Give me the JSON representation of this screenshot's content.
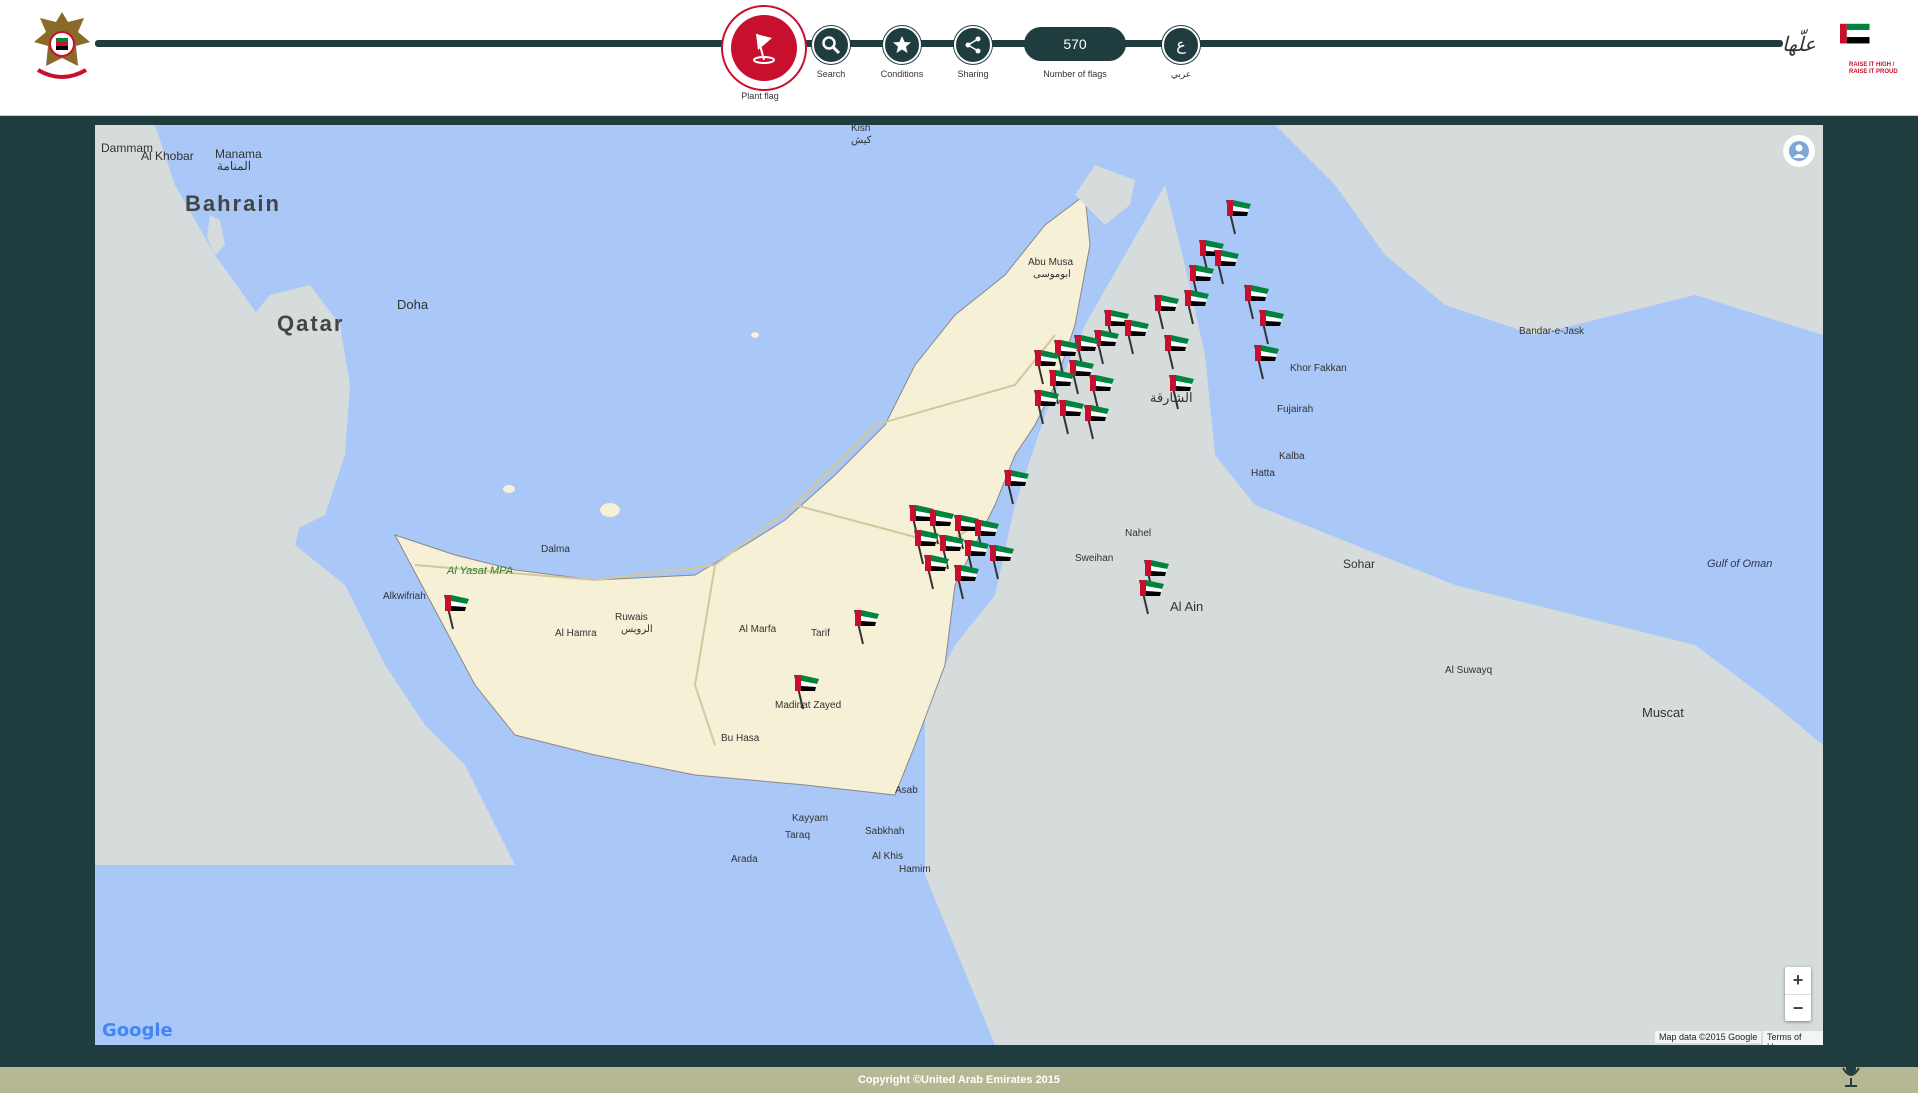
{
  "header": {
    "brand_tagline": "RAISE IT HIGH / RAISE IT PROUD",
    "brand_script": "علّها",
    "toolbar": {
      "plant_flag": "Plant flag",
      "search": "Search",
      "conditions": "Conditions",
      "sharing": "Sharing",
      "flag_count": "570",
      "flag_count_label": "Number of flags",
      "language_glyph": "ع",
      "language_label": "عربي"
    }
  },
  "map": {
    "labels": {
      "bahrain": "Bahrain",
      "qatar": "Qatar",
      "manama": "Manama",
      "manama_ar": "المنامة",
      "dammam": "Dammam",
      "alkhobar": "Al Khobar",
      "doha": "Doha",
      "kish": "Kish",
      "kish_ar": "کیش",
      "abu_musa": "Abu Musa",
      "abu_musa_ar": "ابوموسی",
      "dalma": "Dalma",
      "ruwais": "Ruwais",
      "ruwais_ar": "الرويس",
      "al_hamra": "Al Hamra",
      "al_marfa": "Al Marfa",
      "tarif": "Tarif",
      "madinat_zayed": "Madinat Zayed",
      "bu_hasa": "Bu Hasa",
      "asab": "Asab",
      "kayyam": "Kayyam",
      "taraq": "Taraq",
      "sabkhah": "Sabkhah",
      "arada": "Arada",
      "al_khis": "Al Khis",
      "hamim": "Hamim",
      "nahel": "Nahel",
      "sweihan": "Sweihan",
      "al_ain": "Al Ain",
      "sharjah_ar": "الشارقة",
      "khor_fakkan": "Khor Fakkan",
      "fujairah": "Fujairah",
      "kalba": "Kalba",
      "hatta": "Hatta",
      "sohar": "Sohar",
      "muscat": "Muscat",
      "bandar_e_jask": "Bandar-e-Jask",
      "gulf_of_oman": "Gulf of Oman",
      "al_yasat": "Al Yasat MPA",
      "alkwifriah": "Alkwifriah",
      "al_suwayq": "Al Suwayq"
    },
    "zoom_in": "+",
    "zoom_out": "−",
    "google": "Google",
    "map_data": "Map data ©2015 Google",
    "terms": "Terms of Use"
  },
  "footer": {
    "copyright": "Copyright ©United Arab Emirates 2015"
  },
  "colors": {
    "header_dark": "#1f3c3e",
    "accent_red": "#c8102e",
    "sea": "#a9c7f7",
    "uae_land": "#f5f0d6",
    "other_land": "#d6dbdc",
    "footer": "#b5b892"
  },
  "icons": [
    "uae-emblem-icon",
    "plant-flag-icon",
    "search-icon",
    "star-icon",
    "share-icon",
    "language-icon",
    "pegman-icon",
    "microphone-icon",
    "uae-flag-marker-icon"
  ]
}
